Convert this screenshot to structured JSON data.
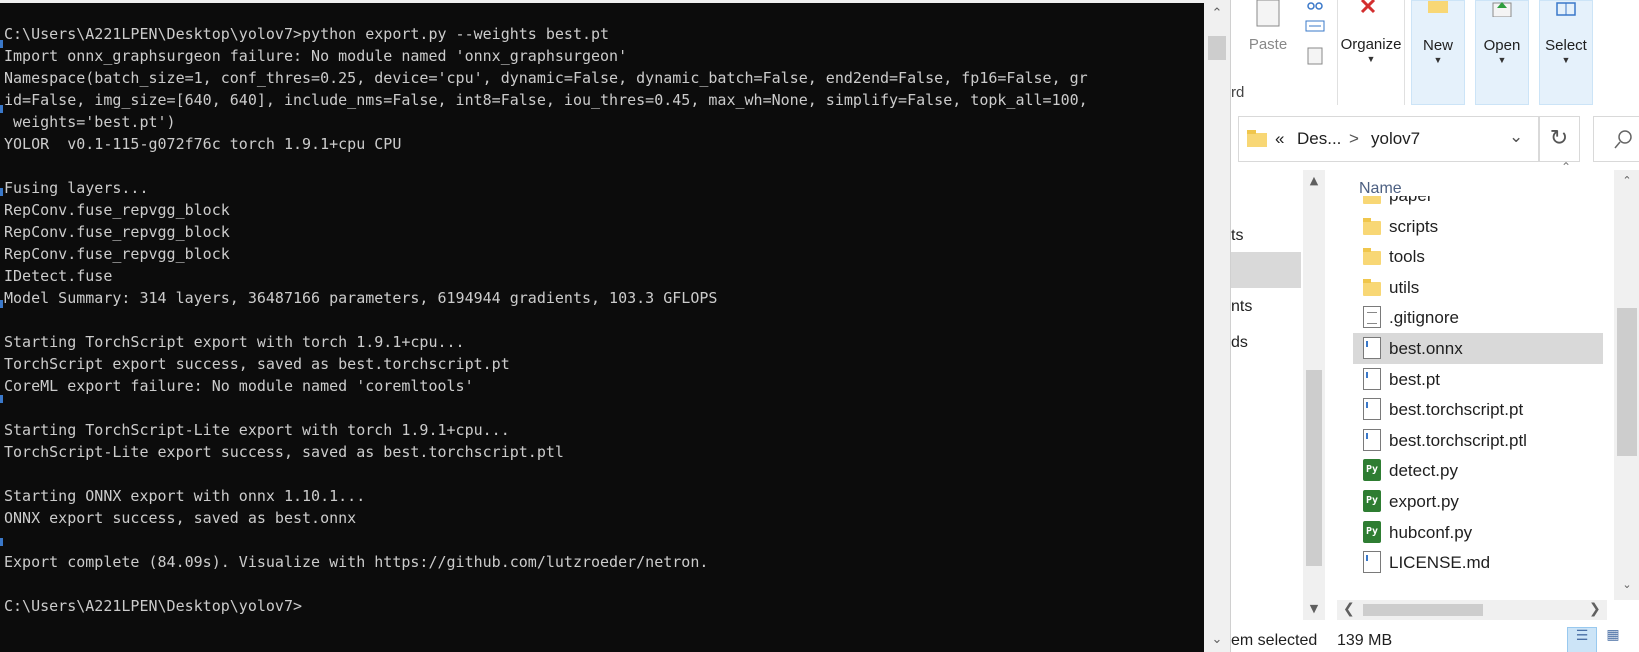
{
  "terminal": {
    "lines": [
      "C:\\Users\\A221LPEN\\Desktop\\yolov7>python export.py --weights best.pt",
      "Import onnx_graphsurgeon failure: No module named 'onnx_graphsurgeon'",
      "Namespace(batch_size=1, conf_thres=0.25, device='cpu', dynamic=False, dynamic_batch=False, end2end=False, fp16=False, gr",
      "id=False, img_size=[640, 640], include_nms=False, int8=False, iou_thres=0.45, max_wh=None, simplify=False, topk_all=100,",
      " weights='best.pt')",
      "YOLOR  v0.1-115-g072f76c torch 1.9.1+cpu CPU",
      "",
      "Fusing layers...",
      "RepConv.fuse_repvgg_block",
      "RepConv.fuse_repvgg_block",
      "RepConv.fuse_repvgg_block",
      "IDetect.fuse",
      "Model Summary: 314 layers, 36487166 parameters, 6194944 gradients, 103.3 GFLOPS",
      "",
      "Starting TorchScript export with torch 1.9.1+cpu...",
      "TorchScript export success, saved as best.torchscript.pt",
      "CoreML export failure: No module named 'coremltools'",
      "",
      "Starting TorchScript-Lite export with torch 1.9.1+cpu...",
      "TorchScript-Lite export success, saved as best.torchscript.ptl",
      "",
      "Starting ONNX export with onnx 1.10.1...",
      "ONNX export success, saved as best.onnx",
      "",
      "Export complete (84.09s). Visualize with https://github.com/lutzroeder/netron.",
      "",
      "C:\\Users\\A221LPEN\\Desktop\\yolov7>"
    ]
  },
  "ribbon": {
    "paste_label": "Paste",
    "clipboard_partial": "rd",
    "organize_label": "Organize",
    "new_label": "New",
    "open_label": "Open",
    "select_label": "Select"
  },
  "address": {
    "chevrons": "«",
    "crumb_1": "Des...",
    "separator": ">",
    "crumb_2": "yolov7"
  },
  "nav_partial": [
    "ts",
    "nts",
    "ds"
  ],
  "columns": {
    "name": "Name"
  },
  "files": [
    {
      "name": "paper",
      "type": "folder"
    },
    {
      "name": "scripts",
      "type": "folder"
    },
    {
      "name": "tools",
      "type": "folder"
    },
    {
      "name": "utils",
      "type": "folder"
    },
    {
      "name": ".gitignore",
      "type": "text"
    },
    {
      "name": "best.onnx",
      "type": "file",
      "selected": true
    },
    {
      "name": "best.pt",
      "type": "file"
    },
    {
      "name": "best.torchscript.pt",
      "type": "file"
    },
    {
      "name": "best.torchscript.ptl",
      "type": "file"
    },
    {
      "name": "detect.py",
      "type": "py"
    },
    {
      "name": "export.py",
      "type": "py"
    },
    {
      "name": "hubconf.py",
      "type": "py"
    },
    {
      "name": "LICENSE.md",
      "type": "file"
    }
  ],
  "status": {
    "selection": "em selected",
    "size": "139 MB"
  },
  "colors": {
    "terminal_bg": "#0c0c0c",
    "terminal_fg": "#cccccc",
    "selection": "#d9d9d9",
    "ribbon_hover": "#e5f1fb"
  }
}
